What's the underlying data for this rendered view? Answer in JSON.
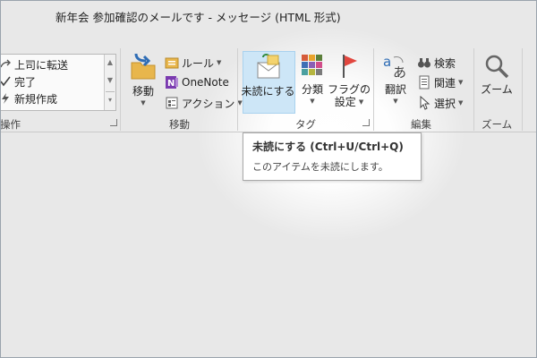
{
  "window": {
    "title": "新年会 参加確認のメールです - メッセージ (HTML 形式)"
  },
  "quick_steps": {
    "items": [
      "上司に転送",
      "完了",
      "新規作成"
    ],
    "group_label": "操作"
  },
  "move_group": {
    "move_label": "移動",
    "rules_label": "ルール",
    "onenote_label": "OneNote",
    "actions_label": "アクション",
    "group_label": "移動"
  },
  "tags_group": {
    "unread_label": "未読にする",
    "categorize_label": "分類",
    "followup_label_1": "フラグの",
    "followup_label_2": "設定",
    "group_label": "タグ"
  },
  "edit_group": {
    "translate_label": "翻訳",
    "find_label": "検索",
    "related_label": "関連",
    "select_label": "選択",
    "group_label": "編集"
  },
  "zoom_group": {
    "zoom_label": "ズーム",
    "group_label": "ズーム"
  },
  "tooltip": {
    "title": "未読にする (Ctrl+U/Ctrl+Q)",
    "description": "このアイテムを未読にします。"
  },
  "colors": {
    "highlight": "#cde6f7",
    "flag_red": "#e2473f",
    "onenote_purple": "#7b3bb0",
    "folder_yellow": "#e8b64c"
  }
}
